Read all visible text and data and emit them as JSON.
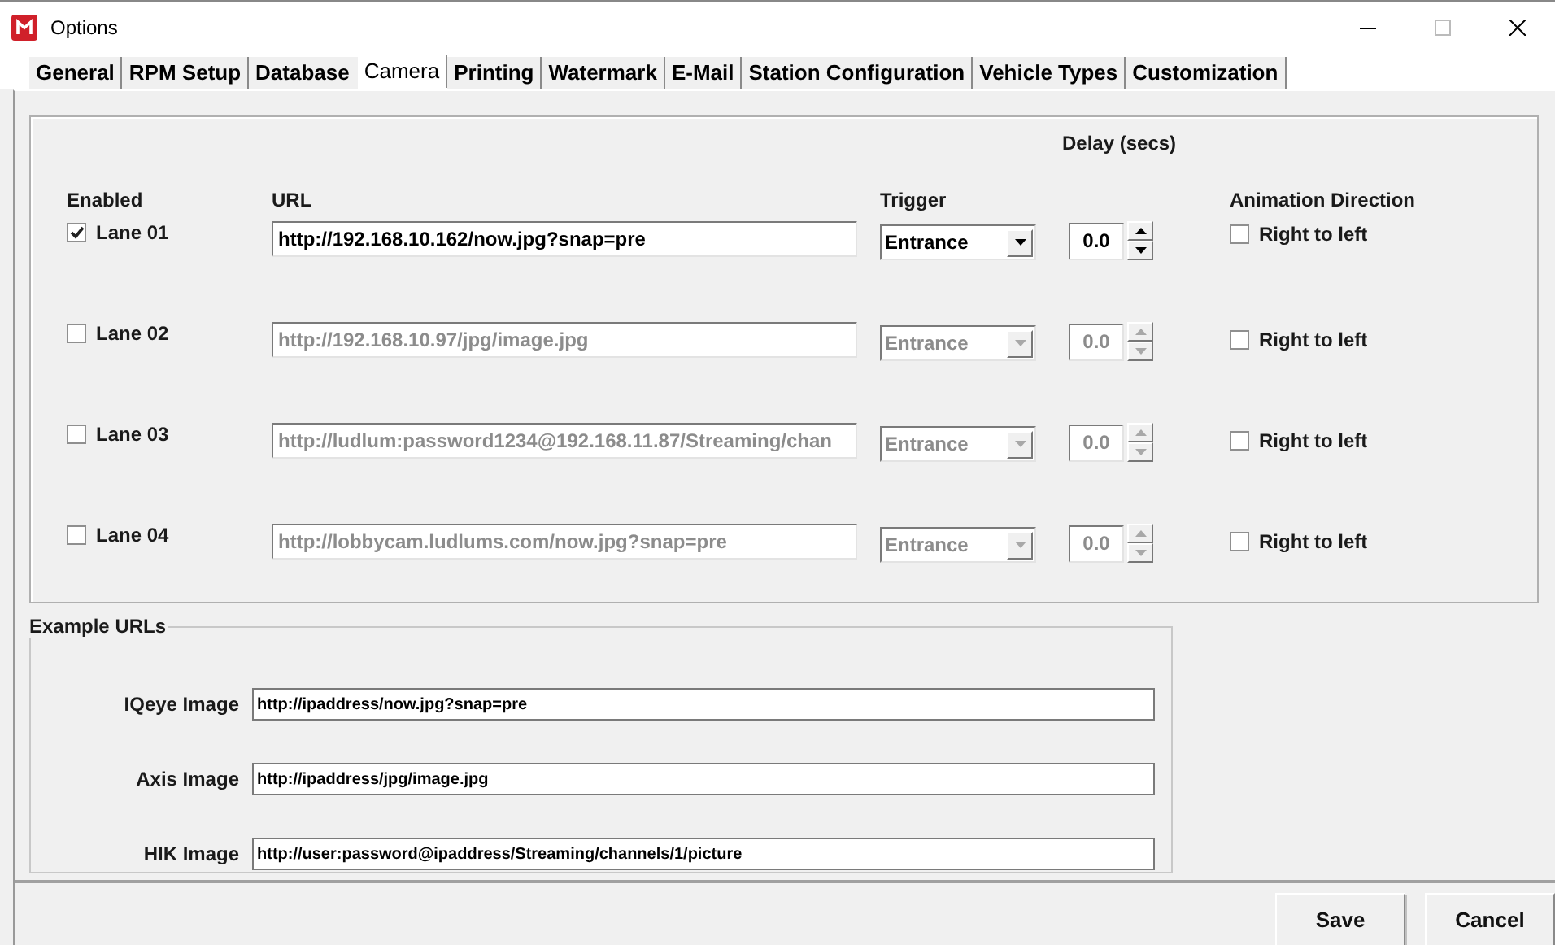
{
  "window": {
    "title": "Options"
  },
  "tabs": [
    {
      "label": "General",
      "selected": false
    },
    {
      "label": "RPM Setup",
      "selected": false
    },
    {
      "label": "Database",
      "selected": false
    },
    {
      "label": "Camera",
      "selected": true
    },
    {
      "label": "Printing",
      "selected": false
    },
    {
      "label": "Watermark",
      "selected": false
    },
    {
      "label": "E-Mail",
      "selected": false
    },
    {
      "label": "Station Configuration",
      "selected": false
    },
    {
      "label": "Vehicle Types",
      "selected": false
    },
    {
      "label": "Customization",
      "selected": false
    }
  ],
  "lanes_header": {
    "enabled": "Enabled",
    "url": "URL",
    "trigger": "Trigger",
    "delay": "Delay (secs)",
    "animation": "Animation Direction"
  },
  "lanes": [
    {
      "label": "Lane 01",
      "enabled": true,
      "url": "http://192.168.10.162/now.jpg?snap=pre",
      "trigger": "Entrance",
      "delay": "0.0",
      "direction_label": "Right to left",
      "right_to_left": false
    },
    {
      "label": "Lane 02",
      "enabled": false,
      "url": "http://192.168.10.97/jpg/image.jpg",
      "trigger": "Entrance",
      "delay": "0.0",
      "direction_label": "Right to left",
      "right_to_left": false
    },
    {
      "label": "Lane 03",
      "enabled": false,
      "url": "http://ludlum:password1234@192.168.11.87/Streaming/chan",
      "trigger": "Entrance",
      "delay": "0.0",
      "direction_label": "Right to left",
      "right_to_left": false
    },
    {
      "label": "Lane 04",
      "enabled": false,
      "url": "http://lobbycam.ludlums.com/now.jpg?snap=pre",
      "trigger": "Entrance",
      "delay": "0.0",
      "direction_label": "Right to left",
      "right_to_left": false
    }
  ],
  "example_urls": {
    "title": "Example URLs",
    "rows": [
      {
        "label": "IQeye Image",
        "url": "http://ipaddress/now.jpg?snap=pre"
      },
      {
        "label": "Axis Image",
        "url": "http://ipaddress/jpg/image.jpg"
      },
      {
        "label": "HIK Image",
        "url": "http://user:password@ipaddress/Streaming/channels/1/picture"
      }
    ]
  },
  "buttons": [
    {
      "label": "Save"
    },
    {
      "label": "Cancel"
    }
  ]
}
